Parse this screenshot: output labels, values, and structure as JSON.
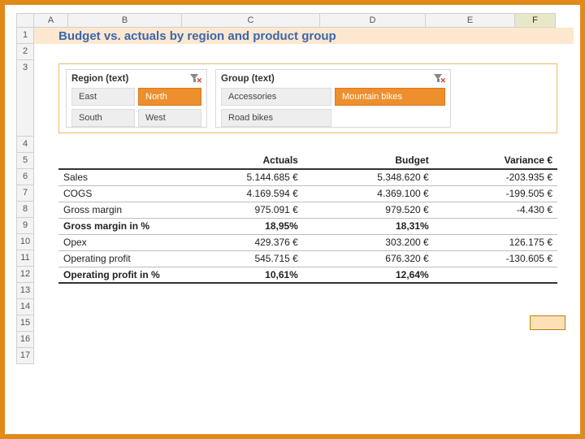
{
  "columns": [
    "",
    "A",
    "B",
    "C",
    "D",
    "E",
    "F"
  ],
  "active_column_index": 6,
  "rows": [
    "1",
    "2",
    "3",
    "4",
    "5",
    "6",
    "7",
    "8",
    "9",
    "10",
    "11",
    "12",
    "13",
    "14",
    "15",
    "16",
    "17"
  ],
  "title": "Budget vs. actuals by region and product group",
  "slicers": {
    "region": {
      "label": "Region (text)",
      "items": [
        {
          "label": "East",
          "selected": false
        },
        {
          "label": "North",
          "selected": true
        },
        {
          "label": "South",
          "selected": false
        },
        {
          "label": "West",
          "selected": false
        }
      ]
    },
    "group": {
      "label": "Group (text)",
      "items": [
        {
          "label": "Accessories",
          "selected": false
        },
        {
          "label": "Mountain bikes",
          "selected": true
        },
        {
          "label": "Road bikes",
          "selected": false
        }
      ]
    }
  },
  "table": {
    "headers": [
      "",
      "Actuals",
      "Budget",
      "Variance €"
    ],
    "rows": [
      {
        "label": "Sales",
        "actuals": "5.144.685 €",
        "budget": "5.348.620 €",
        "variance": "-203.935 €",
        "neg": true
      },
      {
        "label": "COGS",
        "actuals": "4.169.594 €",
        "budget": "4.369.100 €",
        "variance": "-199.505 €",
        "neg": true
      },
      {
        "label": "Gross margin",
        "actuals": "975.091 €",
        "budget": "979.520 €",
        "variance": "-4.430 €",
        "neg": true
      },
      {
        "label": "Gross margin in %",
        "actuals": "18,95%",
        "budget": "18,31%",
        "variance": "",
        "bold": true
      },
      {
        "label": "Opex",
        "actuals": "429.376 €",
        "budget": "303.200 €",
        "variance": "126.175 €"
      },
      {
        "label": "Operating profit",
        "actuals": "545.715 €",
        "budget": "676.320 €",
        "variance": "-130.605 €",
        "neg": true
      },
      {
        "label": "Operating profit in %",
        "actuals": "10,61%",
        "budget": "12,64%",
        "variance": "",
        "bold": true,
        "thick": true
      }
    ]
  }
}
